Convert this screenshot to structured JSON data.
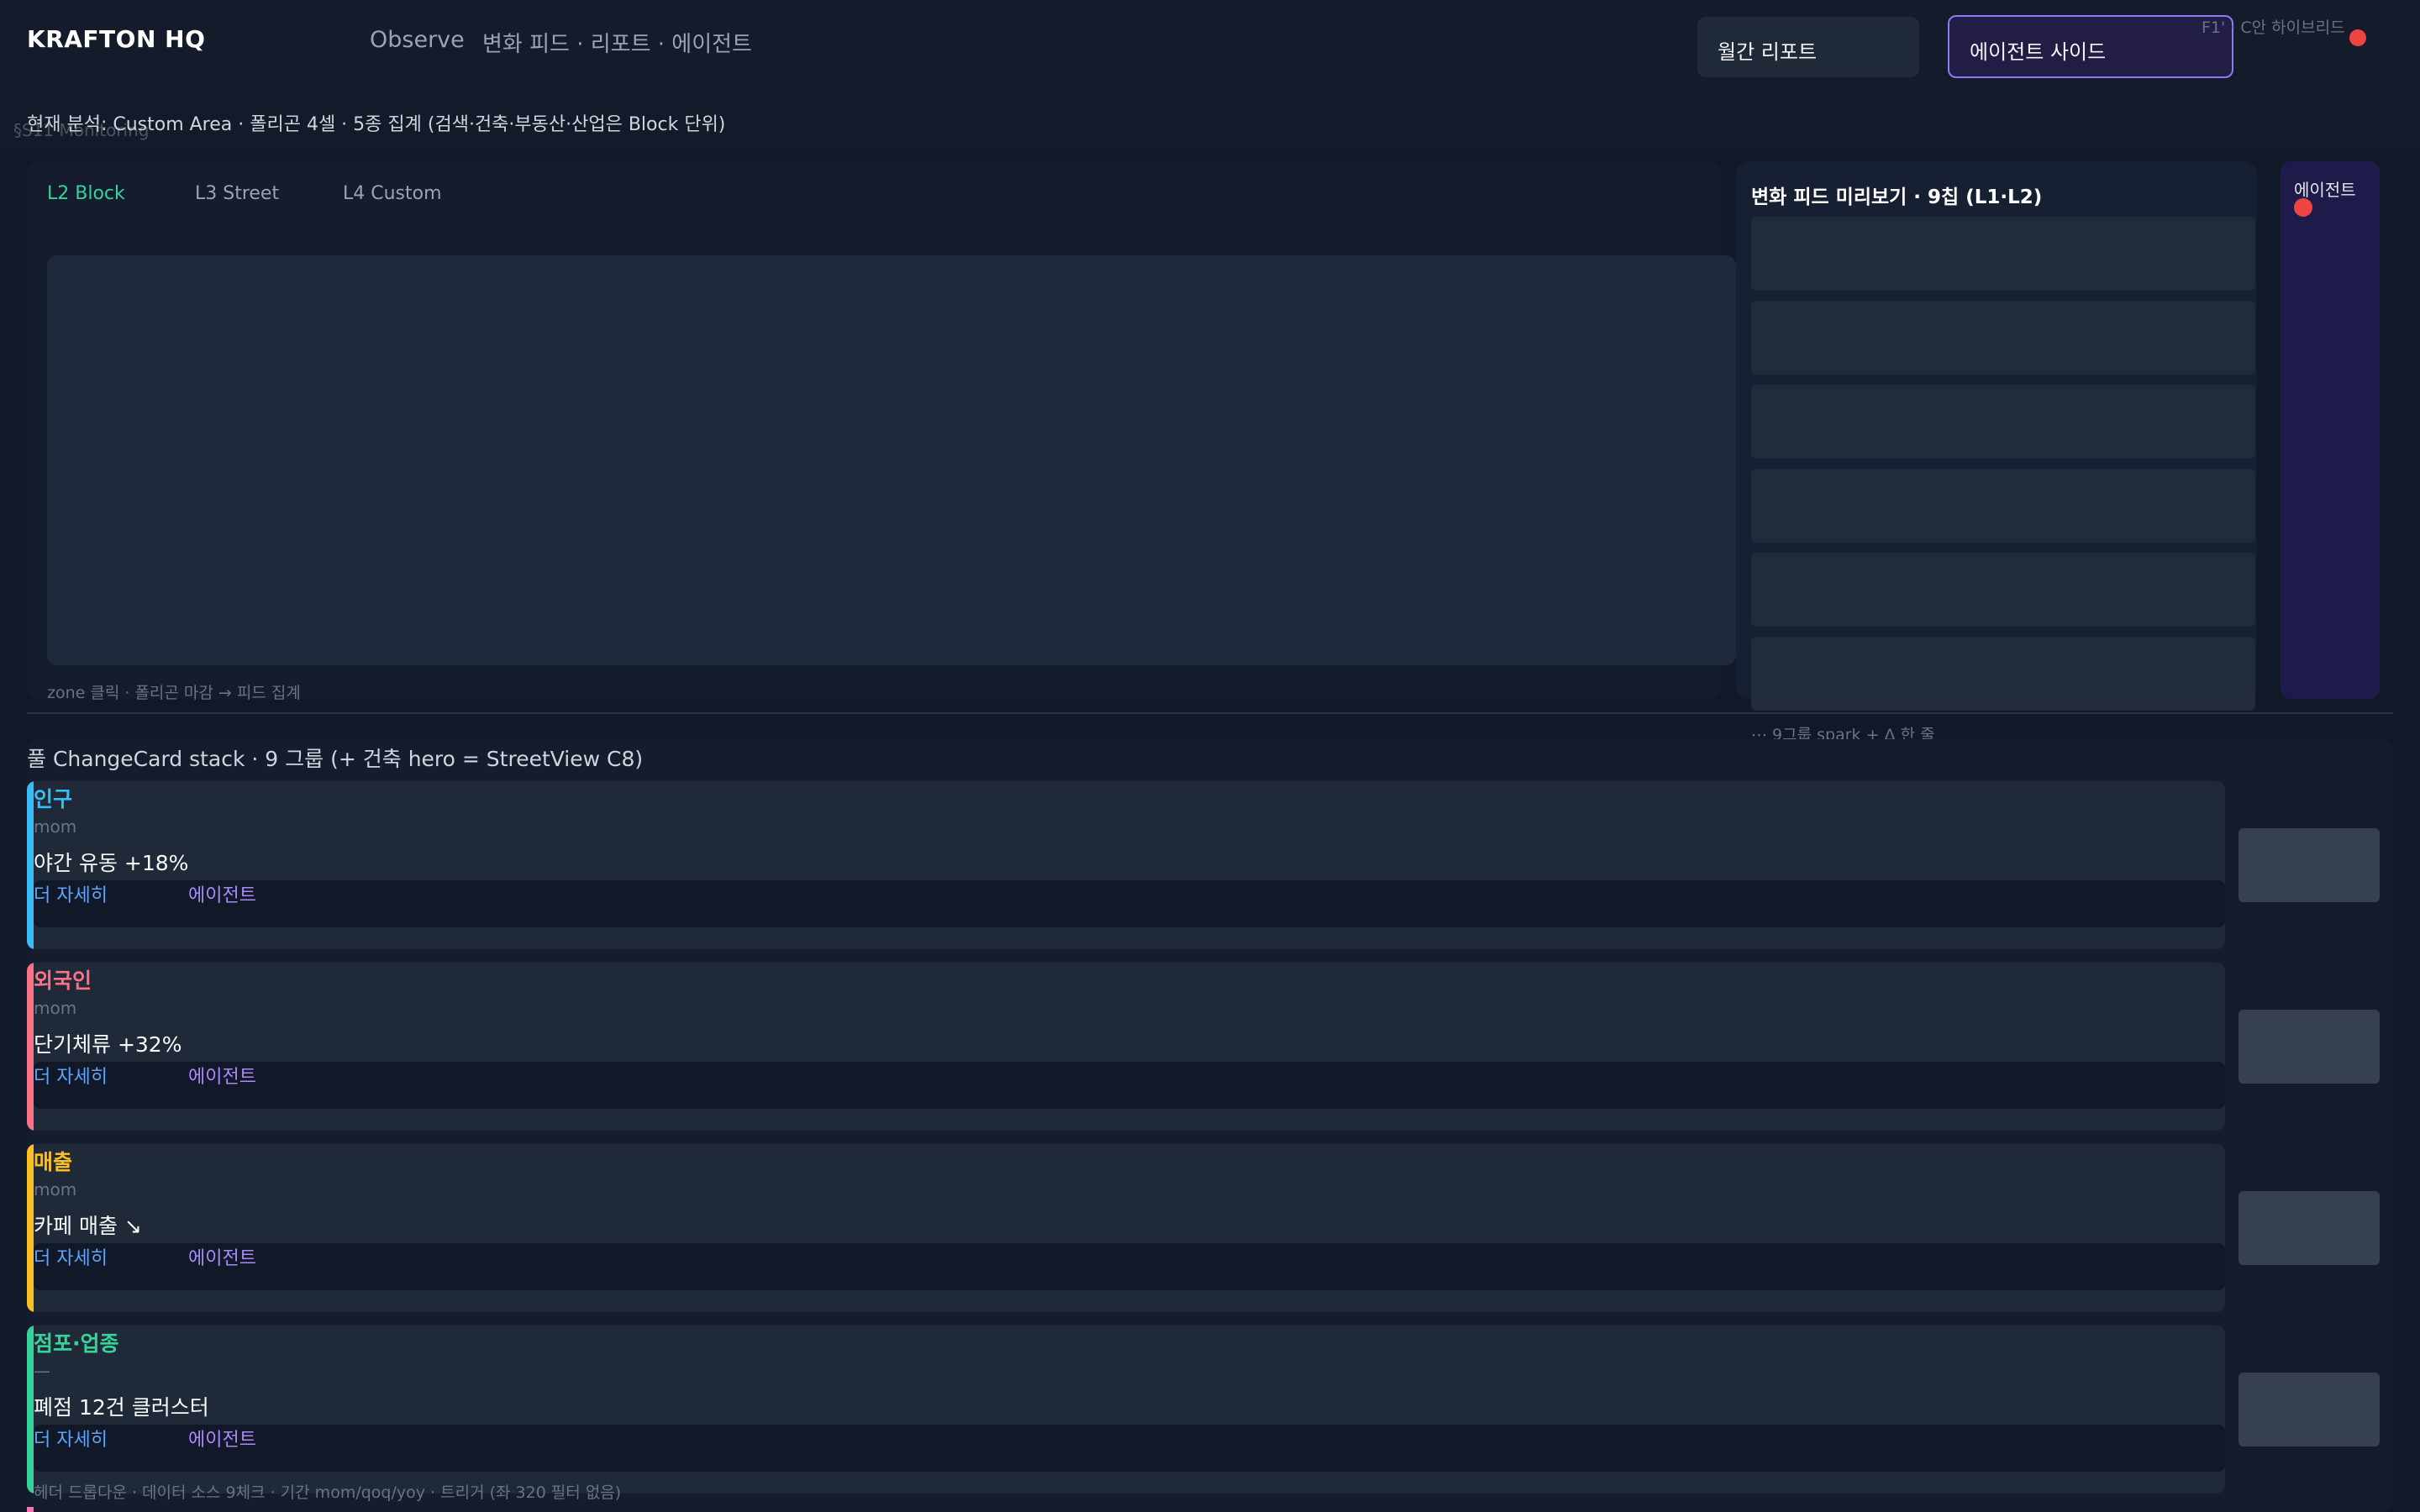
{
  "header": {
    "brand": "KRAFTON HQ",
    "nav_observe": "Observe",
    "nav_links": "변화 피드 · 리포트 · 에이전트",
    "monthly_report": "월간 리포트",
    "agent_side": "에이전트 사이드",
    "hint": "F1' · C안 하이브리드"
  },
  "context": {
    "text": "현재 분석: Custom Area · 폴리곤 4셀 · 5종 집계 (검색·건축·부동산·산업은 Block 단위)",
    "crumb": "§S11 Monitoring"
  },
  "map": {
    "tabs": [
      "L2 Block",
      "L3 Street",
      "L4 Custom"
    ],
    "active_tab": "L2 Block",
    "caption": "zone 클릭 · 폴리곤 마감 → 피드 집계"
  },
  "feed": {
    "title": "변화 피드 미리보기 · 9칩 (L1·L2)",
    "more": "⋯ 9그룹 spark + Δ 한 줄"
  },
  "agent_column": {
    "label": "에이전트"
  },
  "stack": {
    "title": "풀 ChangeCard stack · 9 그룹 (+ 건축 hero = StreetView C8)",
    "cards": [
      {
        "category": "인구",
        "period": "mom",
        "metric": "야간 유동 +18%",
        "color": "#38bdf8",
        "more": "더 자세히",
        "ask": "에이전트"
      },
      {
        "category": "외국인",
        "period": "mom",
        "metric": "단기체류 +32%",
        "color": "#fb7185",
        "more": "더 자세히",
        "ask": "에이전트"
      },
      {
        "category": "매출",
        "period": "mom",
        "metric": "카페 매출 ↘",
        "color": "#fbbf24",
        "more": "더 자세히",
        "ask": "에이전트"
      },
      {
        "category": "점포·업종",
        "period": "—",
        "metric": "폐점 12건 클러스터",
        "color": "#34d399",
        "more": "더 자세히",
        "ask": "에이전트"
      }
    ],
    "footer": "헤더 드롭다운 · 데이터 소스 9체크 · 기간 mom/qoq/yoy · 트리거 (좌 320 필터 없음)"
  },
  "colors": {
    "accent_purple": "#8b7cf6",
    "alert_red": "#ef4444",
    "active_tab_green": "#34d399"
  }
}
